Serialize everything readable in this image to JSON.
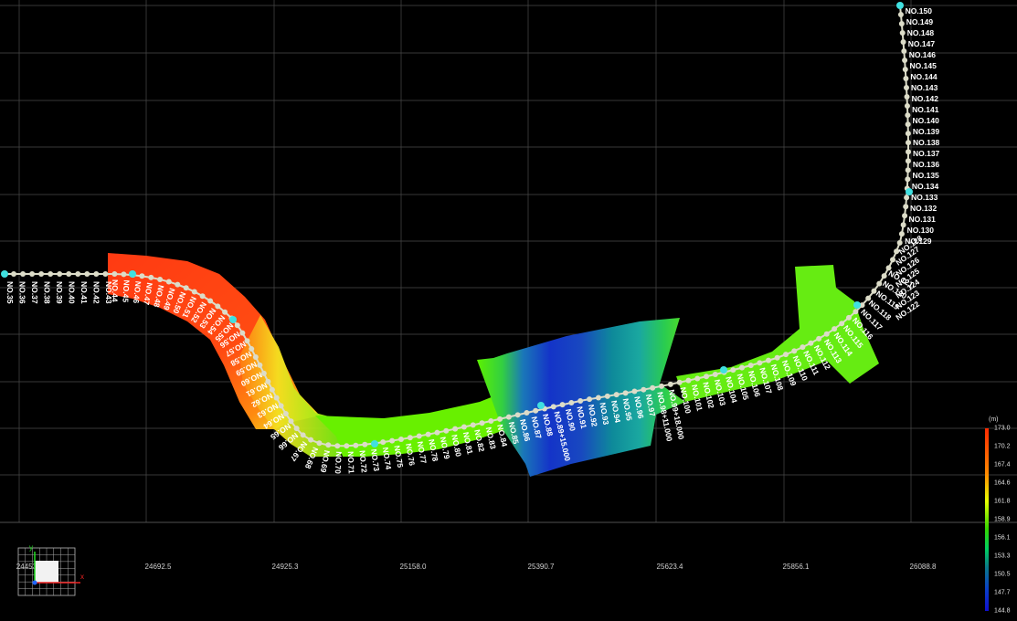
{
  "x_axis_ticks": [
    "24453.",
    "24692.5",
    "24925.3",
    "25158.0",
    "25390.7",
    "25623.4",
    "25856.1",
    "26088.8"
  ],
  "legend": {
    "unit": "(m)",
    "values": [
      "173.0",
      "170.2",
      "167.4",
      "164.6",
      "161.8",
      "158.9",
      "156.1",
      "153.3",
      "150.5",
      "147.7",
      "144.8"
    ]
  },
  "axis_widget": {
    "x_label": "x",
    "y_label": "y"
  },
  "stations": {
    "left_start": 35,
    "left_end": 43,
    "south_start": 44,
    "south_end": 121,
    "north_start": 122,
    "north_end": 150,
    "special_labels": [
      "NO.89+15.000",
      "NO.98+11.000",
      "NO.99+18.000"
    ]
  },
  "colors": {
    "background": "#000000",
    "grid": "#4a4a4a",
    "alignment": "#dcdcc8",
    "station_text": "#ffffff",
    "keypoint": "#40e0e0",
    "terrain_high": "#ff3a10",
    "terrain_mid": "#66ff00",
    "terrain_low": "#1a3cc8"
  }
}
